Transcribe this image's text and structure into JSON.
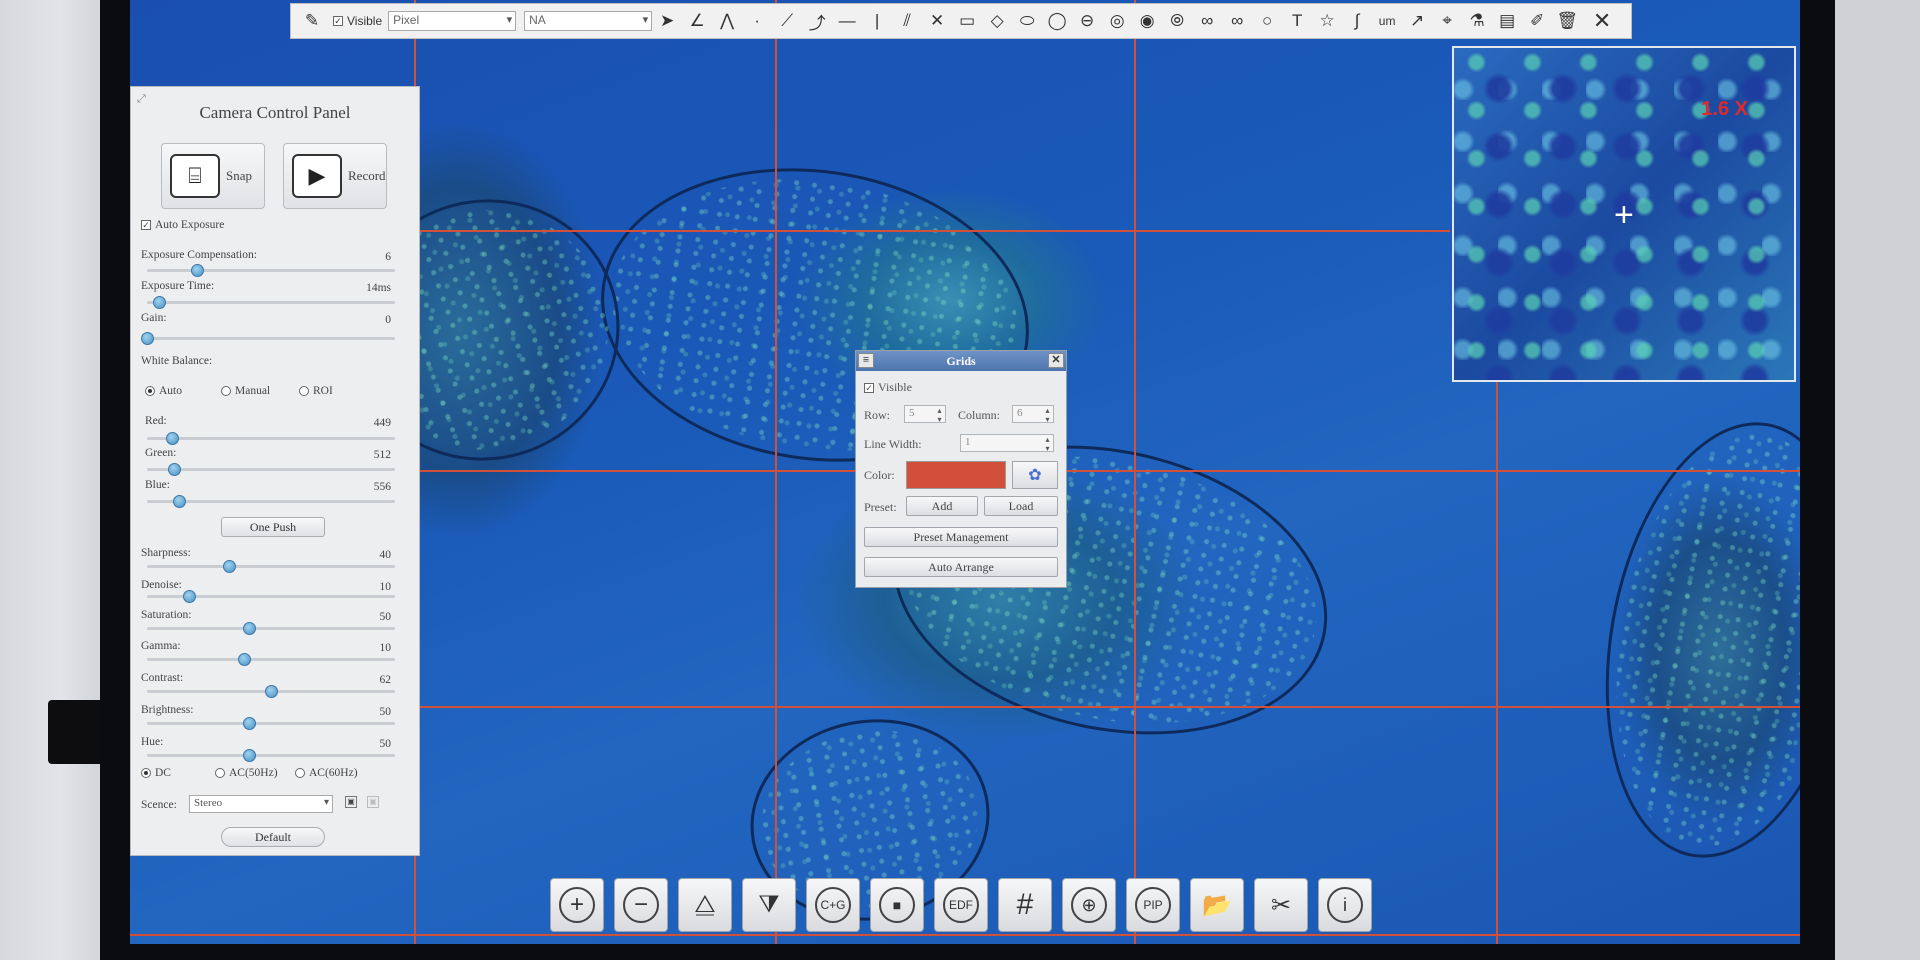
{
  "toolbar": {
    "visible_label": "Visible",
    "unit_select": "Pixel",
    "second_select": "NA",
    "tools": [
      "pointer",
      "angle",
      "polyline-angle",
      "point",
      "line",
      "arbitrary-line",
      "horizontal-line",
      "vertical-line",
      "parallel-lines",
      "cross-lines",
      "rectangle",
      "diamond",
      "ellipse",
      "circle",
      "circle-center",
      "annulus",
      "concentric-circles",
      "two-circles",
      "circle-pair",
      "arc",
      "text",
      "star",
      "curve",
      "arrow",
      "scale-bar",
      "calibrate",
      "layer",
      "settings",
      "delete"
    ],
    "close_icon": "close-icon"
  },
  "camera_panel": {
    "title": "Camera Control Panel",
    "snap_label": "Snap",
    "record_label": "Record",
    "auto_exposure_label": "Auto Exposure",
    "exposure_compensation_label": "Exposure Compensation:",
    "exposure_compensation_value": "6",
    "exposure_compensation_level": 0.2,
    "exposure_time_label": "Exposure Time:",
    "exposure_time_value": "14ms",
    "exposure_time_level": 0.05,
    "gain_label": "Gain:",
    "gain_value": "0",
    "gain_level": 0.0,
    "white_balance_label": "White Balance:",
    "wb_auto": "Auto",
    "wb_manual": "Manual",
    "wb_roi": "ROI",
    "red_label": "Red:",
    "red_value": "449",
    "red_level": 0.1,
    "green_label": "Green:",
    "green_value": "512",
    "green_level": 0.11,
    "blue_label": "Blue:",
    "blue_value": "556",
    "blue_level": 0.13,
    "one_push_label": "One Push",
    "sharpness_label": "Sharpness:",
    "sharpness_value": "40",
    "sharpness_level": 0.33,
    "denoise_label": "Denoise:",
    "denoise_value": "10",
    "denoise_level": 0.17,
    "saturation_label": "Saturation:",
    "saturation_value": "50",
    "saturation_level": 0.41,
    "gamma_label": "Gamma:",
    "gamma_value": "10",
    "gamma_level": 0.39,
    "contrast_label": "Contrast:",
    "contrast_value": "62",
    "contrast_level": 0.5,
    "brightness_label": "Brightness:",
    "brightness_value": "50",
    "brightness_level": 0.41,
    "hue_label": "Hue:",
    "hue_value": "50",
    "hue_level": 0.41,
    "power_dc": "DC",
    "power_ac50": "AC(50Hz)",
    "power_ac60": "AC(60Hz)",
    "scene_label": "Scence:",
    "scene_value": "Stereo",
    "default_label": "Default"
  },
  "grids_dialog": {
    "title": "Grids",
    "visible_label": "Visible",
    "row_label": "Row:",
    "row_value": "5",
    "column_label": "Column:",
    "column_value": "6",
    "line_width_label": "Line Width:",
    "line_width_value": "1",
    "color_label": "Color:",
    "color_value": "#d2503a",
    "preset_label": "Preset:",
    "add_label": "Add",
    "load_label": "Load",
    "preset_management_label": "Preset Management",
    "auto_arrange_label": "Auto Arrange"
  },
  "zoom_preview": {
    "magnification": "1.6 X"
  },
  "bottom_bar": {
    "edf_label": "EDF",
    "pip_label": "PIP",
    "cg_label": "C+G"
  },
  "colors": {
    "grid_line": "#d2503a",
    "zoom_label": "#e12a2a"
  }
}
